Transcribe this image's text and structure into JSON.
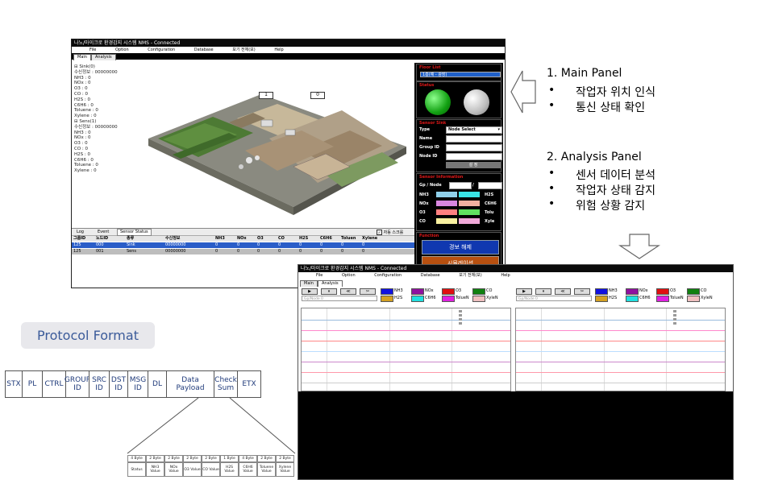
{
  "main_window": {
    "title": "나노/마이크로 환경감지 시스템 NMS - Connected",
    "menu": [
      "File",
      "Option",
      "Configuration",
      "Database",
      "보기 전체(보)",
      "Help"
    ],
    "tabs": [
      "Main",
      "Analysis"
    ],
    "tree": [
      "⊟ Sink(0)",
      "    수신정보 : 00000000",
      "    NH3 : 0",
      "    NOx : 0",
      "    O3 : 0",
      "    CO : 0",
      "    H2S : 0",
      "    C6H6 : 0",
      "    Toluene : 0",
      "    Xylene : 0",
      "⊟ Sens(1)",
      "    수신정보 : 00000000",
      "    NH3 : 0",
      "    NOx : 0",
      "    O3 : 0",
      "    CO : 0",
      "    H2S : 0",
      "    C6H6 : 0",
      "    Toluene : 0",
      "    Xylene : 0"
    ],
    "map_box_1": "1",
    "map_box_2": "0",
    "right_panel": {
      "floor_title": "Floor List",
      "floor_value": "1층(예 - 광장)",
      "status_title": "Status",
      "sensor_sink_title": "Sensor Sink",
      "type_label": "Type",
      "type_value": "Node Select",
      "name_label": "Name",
      "group_label": "Group ID",
      "node_label": "Node ID",
      "set_button": "설 정",
      "sensor_info_title": "Sensor Information",
      "gp_node_label": "Gp / Node",
      "gp_sep": "/",
      "gas_rows": [
        {
          "left": "NH3",
          "right": "H2S",
          "lc": "#8fd0ea",
          "rc": "#39e3e6"
        },
        {
          "left": "NOx",
          "right": "C6H6",
          "lc": "#d987e0",
          "rc": "#f0b0a0"
        },
        {
          "left": "O3",
          "right": "Tolu",
          "lc": "#ff8080",
          "rc": "#60e060"
        },
        {
          "left": "CO",
          "right": "Xyle",
          "lc": "#f8f0a0",
          "rc": "#f0a8d8"
        }
      ],
      "function_title": "Function",
      "alarm_button": "경보 해제",
      "sim_button": "시뮬레이션"
    },
    "bottom_tabs": [
      "Log",
      "Event",
      "Sensor Status"
    ],
    "bottom_checkbox": "자동 스크롤",
    "grid_headers": [
      "그룹ID",
      "노드ID",
      "종류",
      "수신정보",
      "NH3",
      "NOx",
      "O3",
      "CO",
      "H2S",
      "C6H6",
      "Toluen",
      "Xylene"
    ],
    "grid_rows": [
      [
        "125",
        "000",
        "Sink",
        "00000000",
        "0",
        "0",
        "0",
        "0",
        "0",
        "0",
        "0",
        "0"
      ],
      [
        "125",
        "001",
        "Sens",
        "00000000",
        "0",
        "0",
        "0",
        "0",
        "0",
        "0",
        "0",
        "0"
      ]
    ]
  },
  "analysis_window": {
    "title": "나노/마이크로 환경감지 시스템 NMS - Connected",
    "menu": [
      "File",
      "Option",
      "Configuration",
      "Database",
      "보기 전체(보)",
      "Help"
    ],
    "tabs": [
      "Main",
      "Analysis"
    ],
    "tool_buttons": [
      "▶",
      "⏸",
      "≪",
      "✂"
    ],
    "legend": [
      {
        "name": "NH3",
        "color": "#1010e0"
      },
      {
        "name": "NOx",
        "color": "#9010a0"
      },
      {
        "name": "O3",
        "color": "#e01010"
      },
      {
        "name": "CO",
        "color": "#108010"
      },
      {
        "name": "H2S",
        "color": "#d4a020"
      },
      {
        "name": "C6H6",
        "color": "#20e0e0"
      },
      {
        "name": "TolueN",
        "color": "#e020e0"
      },
      {
        "name": "XyleN",
        "color": "#f0c0c0"
      }
    ],
    "node_label": "Gp/Node 0"
  },
  "annotations": {
    "main_title": "1. Main Panel",
    "main_items": [
      "작업자 위치 인식",
      "통신 상태 확인"
    ],
    "analysis_title": "2. Analysis Panel",
    "analysis_items": [
      "센서 데이터 분석",
      "작업자 상태 감지",
      "위험 상황 감지"
    ],
    "bullet": "•"
  },
  "protocol": {
    "title": "Protocol Format",
    "fields": [
      "STX",
      "PL",
      "CTRL",
      "GROUP ID",
      "SRC ID",
      "DST ID",
      "MSG ID",
      "DL",
      "Data  Payload",
      "Check Sum",
      "ETX"
    ],
    "payload_sizes": [
      "4 Byte",
      "2 Byte",
      "2 Byte",
      "2 Byte",
      "2 Byte",
      "1 Byte",
      "4 Byte",
      "2 Byte",
      "2 Byte"
    ],
    "payload_names": [
      "Status",
      "NH3 Value",
      "NOx Value",
      "O3 Value",
      "CO Value",
      "H2S Value",
      "C6H6 Value",
      "Toluene Value",
      "Xylene Value"
    ]
  }
}
